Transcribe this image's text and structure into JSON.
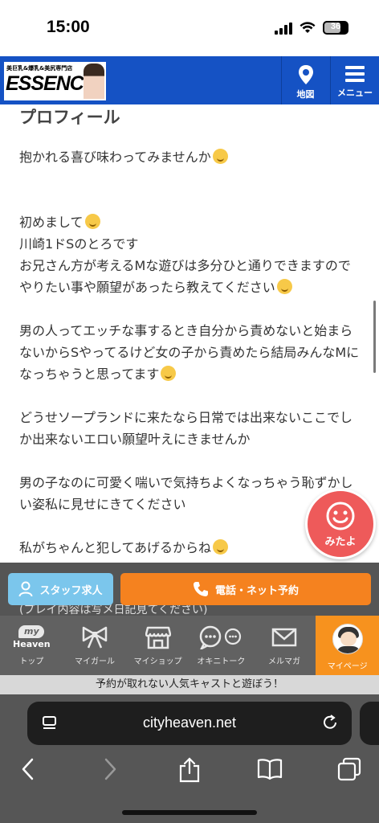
{
  "status_bar": {
    "time": "15:00",
    "battery": "36"
  },
  "header": {
    "logo_tagline": "美巨乳&爆乳&美尻専門店",
    "logo_name": "ESSENCE",
    "map_label": "地図",
    "menu_label": "メニュー",
    "color": "#1552c4"
  },
  "content": {
    "title": "プロフィール",
    "paragraphs": [
      [
        "抱かれる喜び味わってみませんか"
      ],
      [
        "初めまして",
        "川崎1ドSのとろです",
        "お兄さん方が考えるMな遊びは多分ひと通りできますのでやりたい事や願望があったら教えてください"
      ],
      [
        "男の人ってエッチな事するとき自分から責めないと始まらないからSやってるけど女の子から責めたら結局みんなMになっちゃうと思ってます"
      ],
      [
        "どうせソープランドに来たなら日常では出来ないここでしか出来ないエロい願望叶えにきませんか"
      ],
      [
        "男の子なのに可愛く喘いで気持ちよくなっちゃう恥ずかしい姿私に見せにきてください"
      ],
      [
        "私がちゃんと犯してあげるからね"
      ]
    ],
    "partial_text": "(プレイ内容は写メ日記見てください)"
  },
  "fab": {
    "label": "みたよ",
    "icon": "smile-icon",
    "color": "#ee5a5a"
  },
  "cta": {
    "staff_label": "スタッフ求人",
    "call_label": "電話・ネット予約",
    "staff_color": "#7bc6ec",
    "call_color": "#f5821f"
  },
  "tabbar": {
    "items": [
      {
        "label": "トップ",
        "icon": "my-heaven-icon"
      },
      {
        "label": "マイガール",
        "icon": "ribbon-icon"
      },
      {
        "label": "マイショップ",
        "icon": "shop-icon"
      },
      {
        "label": "オキニトーク",
        "icon": "chat-icon"
      },
      {
        "label": "メルマガ",
        "icon": "mail-icon"
      },
      {
        "label": "マイページ",
        "icon": "avatar-icon"
      }
    ],
    "heaven_logo_top": "my",
    "heaven_logo_bottom": "Heaven",
    "active_color": "#f7921e"
  },
  "promo": "予約が取れない人気キャストと遊ぼう！",
  "browser": {
    "url": "cityheaven.net"
  }
}
